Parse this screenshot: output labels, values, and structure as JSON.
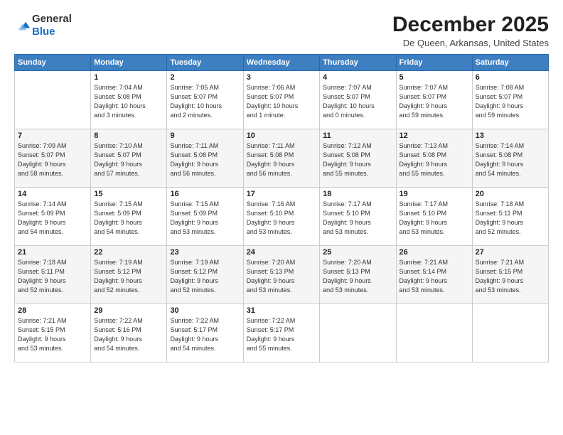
{
  "logo": {
    "general": "General",
    "blue": "Blue"
  },
  "title": "December 2025",
  "location": "De Queen, Arkansas, United States",
  "days_header": [
    "Sunday",
    "Monday",
    "Tuesday",
    "Wednesday",
    "Thursday",
    "Friday",
    "Saturday"
  ],
  "weeks": [
    [
      {
        "day": "",
        "info": ""
      },
      {
        "day": "1",
        "info": "Sunrise: 7:04 AM\nSunset: 5:08 PM\nDaylight: 10 hours\nand 3 minutes."
      },
      {
        "day": "2",
        "info": "Sunrise: 7:05 AM\nSunset: 5:07 PM\nDaylight: 10 hours\nand 2 minutes."
      },
      {
        "day": "3",
        "info": "Sunrise: 7:06 AM\nSunset: 5:07 PM\nDaylight: 10 hours\nand 1 minute."
      },
      {
        "day": "4",
        "info": "Sunrise: 7:07 AM\nSunset: 5:07 PM\nDaylight: 10 hours\nand 0 minutes."
      },
      {
        "day": "5",
        "info": "Sunrise: 7:07 AM\nSunset: 5:07 PM\nDaylight: 9 hours\nand 59 minutes."
      },
      {
        "day": "6",
        "info": "Sunrise: 7:08 AM\nSunset: 5:07 PM\nDaylight: 9 hours\nand 59 minutes."
      }
    ],
    [
      {
        "day": "7",
        "info": "Sunrise: 7:09 AM\nSunset: 5:07 PM\nDaylight: 9 hours\nand 58 minutes."
      },
      {
        "day": "8",
        "info": "Sunrise: 7:10 AM\nSunset: 5:07 PM\nDaylight: 9 hours\nand 57 minutes."
      },
      {
        "day": "9",
        "info": "Sunrise: 7:11 AM\nSunset: 5:08 PM\nDaylight: 9 hours\nand 56 minutes."
      },
      {
        "day": "10",
        "info": "Sunrise: 7:11 AM\nSunset: 5:08 PM\nDaylight: 9 hours\nand 56 minutes."
      },
      {
        "day": "11",
        "info": "Sunrise: 7:12 AM\nSunset: 5:08 PM\nDaylight: 9 hours\nand 55 minutes."
      },
      {
        "day": "12",
        "info": "Sunrise: 7:13 AM\nSunset: 5:08 PM\nDaylight: 9 hours\nand 55 minutes."
      },
      {
        "day": "13",
        "info": "Sunrise: 7:14 AM\nSunset: 5:08 PM\nDaylight: 9 hours\nand 54 minutes."
      }
    ],
    [
      {
        "day": "14",
        "info": "Sunrise: 7:14 AM\nSunset: 5:09 PM\nDaylight: 9 hours\nand 54 minutes."
      },
      {
        "day": "15",
        "info": "Sunrise: 7:15 AM\nSunset: 5:09 PM\nDaylight: 9 hours\nand 54 minutes."
      },
      {
        "day": "16",
        "info": "Sunrise: 7:15 AM\nSunset: 5:09 PM\nDaylight: 9 hours\nand 53 minutes."
      },
      {
        "day": "17",
        "info": "Sunrise: 7:16 AM\nSunset: 5:10 PM\nDaylight: 9 hours\nand 53 minutes."
      },
      {
        "day": "18",
        "info": "Sunrise: 7:17 AM\nSunset: 5:10 PM\nDaylight: 9 hours\nand 53 minutes."
      },
      {
        "day": "19",
        "info": "Sunrise: 7:17 AM\nSunset: 5:10 PM\nDaylight: 9 hours\nand 53 minutes."
      },
      {
        "day": "20",
        "info": "Sunrise: 7:18 AM\nSunset: 5:11 PM\nDaylight: 9 hours\nand 52 minutes."
      }
    ],
    [
      {
        "day": "21",
        "info": "Sunrise: 7:18 AM\nSunset: 5:11 PM\nDaylight: 9 hours\nand 52 minutes."
      },
      {
        "day": "22",
        "info": "Sunrise: 7:19 AM\nSunset: 5:12 PM\nDaylight: 9 hours\nand 52 minutes."
      },
      {
        "day": "23",
        "info": "Sunrise: 7:19 AM\nSunset: 5:12 PM\nDaylight: 9 hours\nand 52 minutes."
      },
      {
        "day": "24",
        "info": "Sunrise: 7:20 AM\nSunset: 5:13 PM\nDaylight: 9 hours\nand 53 minutes."
      },
      {
        "day": "25",
        "info": "Sunrise: 7:20 AM\nSunset: 5:13 PM\nDaylight: 9 hours\nand 53 minutes."
      },
      {
        "day": "26",
        "info": "Sunrise: 7:21 AM\nSunset: 5:14 PM\nDaylight: 9 hours\nand 53 minutes."
      },
      {
        "day": "27",
        "info": "Sunrise: 7:21 AM\nSunset: 5:15 PM\nDaylight: 9 hours\nand 53 minutes."
      }
    ],
    [
      {
        "day": "28",
        "info": "Sunrise: 7:21 AM\nSunset: 5:15 PM\nDaylight: 9 hours\nand 53 minutes."
      },
      {
        "day": "29",
        "info": "Sunrise: 7:22 AM\nSunset: 5:16 PM\nDaylight: 9 hours\nand 54 minutes."
      },
      {
        "day": "30",
        "info": "Sunrise: 7:22 AM\nSunset: 5:17 PM\nDaylight: 9 hours\nand 54 minutes."
      },
      {
        "day": "31",
        "info": "Sunrise: 7:22 AM\nSunset: 5:17 PM\nDaylight: 9 hours\nand 55 minutes."
      },
      {
        "day": "",
        "info": ""
      },
      {
        "day": "",
        "info": ""
      },
      {
        "day": "",
        "info": ""
      }
    ]
  ]
}
